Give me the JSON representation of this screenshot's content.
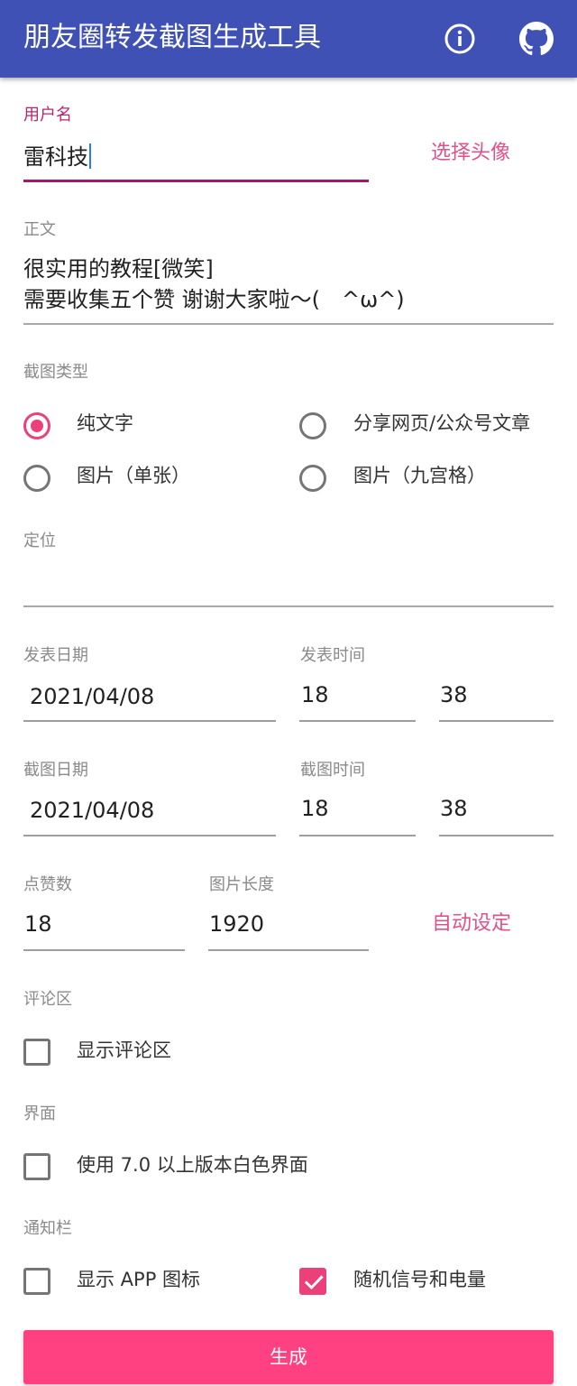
{
  "appbar": {
    "title": "朋友圈转发截图生成工具",
    "bg_color": "#3f51b5",
    "icons": [
      "info-icon",
      "github-icon"
    ]
  },
  "username": {
    "label": "用户名",
    "value": "雷科技",
    "choose_avatar": "选择头像"
  },
  "body": {
    "label": "正文",
    "lines": [
      "很实用的教程[微笑]",
      "需要收集五个赞 谢谢大家啦～(　^ω^)"
    ]
  },
  "screenshot_type": {
    "label": "截图类型",
    "options": [
      {
        "label": "纯文字",
        "selected": true
      },
      {
        "label": "分享网页/公众号文章",
        "selected": false
      },
      {
        "label": "图片（单张）",
        "selected": false
      },
      {
        "label": "图片（九宫格）",
        "selected": false
      }
    ]
  },
  "location": {
    "label": "定位",
    "value": ""
  },
  "post": {
    "date_label": "发表日期",
    "date": "2021/04/08",
    "time_label": "发表时间",
    "hour": "18",
    "minute": "38"
  },
  "shot": {
    "date_label": "截图日期",
    "date": "2021/04/08",
    "time_label": "截图时间",
    "hour": "18",
    "minute": "38"
  },
  "likes": {
    "label": "点赞数",
    "value": "18"
  },
  "image_length": {
    "label": "图片长度",
    "value": "1920",
    "auto_button": "自动设定"
  },
  "comments": {
    "label": "评论区",
    "show_label": "显示评论区",
    "checked": false
  },
  "ui": {
    "label": "界面",
    "white_label": "使用 7.0 以上版本白色界面",
    "checked": false
  },
  "statusbar": {
    "label": "通知栏",
    "app_icon_label": "显示 APP 图标",
    "app_icon_checked": false,
    "random_label": "随机信号和电量",
    "random_checked": true
  },
  "generate_button": "生成",
  "colors": {
    "accent": "#ff4081",
    "focus_underline": "#a3186b",
    "text_button": "#e0508a"
  }
}
